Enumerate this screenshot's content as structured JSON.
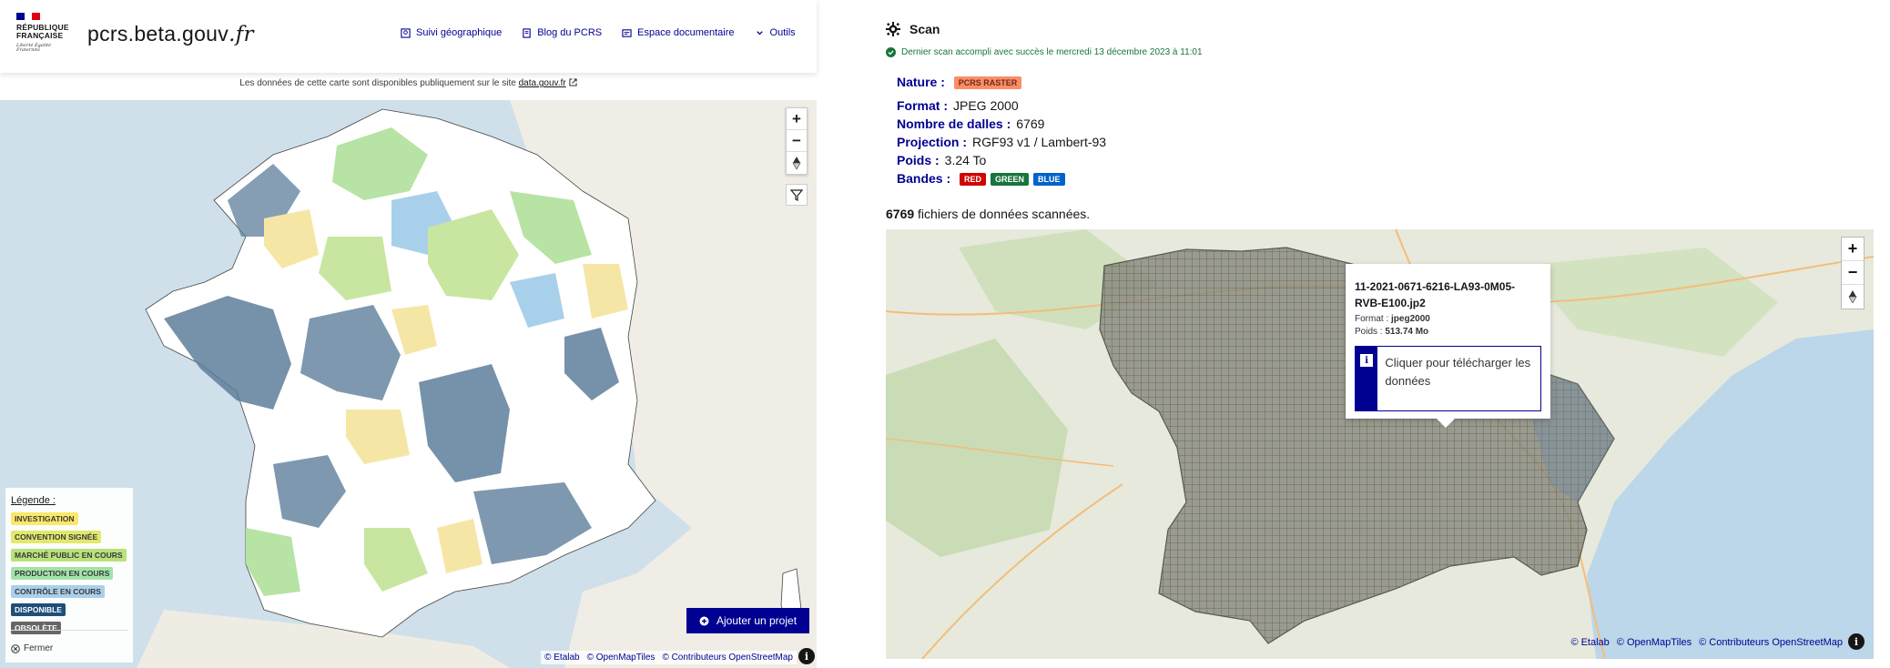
{
  "header": {
    "gov_name_line1": "RÉPUBLIQUE",
    "gov_name_line2": "FRANÇAISE",
    "motto": "Liberté Égalité Fraternité",
    "site_name": "pcrs.beta.gouv",
    "site_tld": ".fr",
    "nav": [
      {
        "label": "Suivi géographique",
        "icon": "map-icon"
      },
      {
        "label": "Blog du PCRS",
        "icon": "book-icon"
      },
      {
        "label": "Espace documentaire",
        "icon": "document-icon"
      },
      {
        "label": "Outils",
        "icon": "chevron-down-icon"
      }
    ]
  },
  "notice": {
    "text": "Les données de cette carte sont disponibles publiquement sur le site",
    "link": "data.gouv.fr"
  },
  "left_map": {
    "zoom_in": "+",
    "zoom_out": "−",
    "legend": {
      "title": "Légende :",
      "items": [
        {
          "label": "INVESTIGATION",
          "bg": "#fbe769",
          "fg": "#3a3a3a"
        },
        {
          "label": "CONVENTION SIGNÉE",
          "bg": "#e2e86b",
          "fg": "#3a3a3a"
        },
        {
          "label": "MARCHÉ PUBLIC EN COURS",
          "bg": "#b8e17a",
          "fg": "#3a3a3a"
        },
        {
          "label": "PRODUCTION EN COURS",
          "bg": "#a3e3a8",
          "fg": "#3a3a3a"
        },
        {
          "label": "CONTRÔLE EN COURS",
          "bg": "#a9d0ea",
          "fg": "#3a3a3a"
        },
        {
          "label": "DISPONIBLE",
          "bg": "#1f4e79",
          "fg": "#ffffff"
        },
        {
          "label": "OBSOLÈTE",
          "bg": "#666666",
          "fg": "#ffffff"
        }
      ],
      "close_label": "Fermer"
    },
    "add_project_label": "Ajouter un projet",
    "attribution": [
      "© Etalab",
      "© OpenMapTiles",
      "© Contributeurs OpenStreetMap"
    ]
  },
  "scan": {
    "title": "Scan",
    "last_scan": "Dernier scan accompli avec succès le mercredi 13 décembre 2023 à 11:01",
    "nature_label": "Nature :",
    "nature_value": "PCRS RASTER",
    "format_label": "Format :",
    "format_value": "JPEG 2000",
    "dalles_label": "Nombre de dalles :",
    "dalles_value": "6769",
    "projection_label": "Projection :",
    "projection_value": "RGF93 v1 / Lambert-93",
    "poids_label": "Poids :",
    "poids_value": "3.24 To",
    "bandes_label": "Bandes :",
    "bandes": [
      {
        "label": "RED",
        "bg": "#ce0500"
      },
      {
        "label": "GREEN",
        "bg": "#18753c"
      },
      {
        "label": "BLUE",
        "bg": "#0063cb"
      }
    ],
    "files_count": "6769",
    "files_text": "fichiers de données scannées."
  },
  "right_map": {
    "popup": {
      "filename": "11-2021-0671-6216-LA93-0M05-RVB-E100.jp2",
      "format_label": "Format :",
      "format_value": "jpeg2000",
      "poids_label": "Poids :",
      "poids_value": "513.74 Mo",
      "download_label": "Cliquer pour télécharger les données"
    },
    "attribution": [
      "© Etalab",
      "© OpenMapTiles",
      "© Contributeurs OpenStreetMap"
    ]
  }
}
